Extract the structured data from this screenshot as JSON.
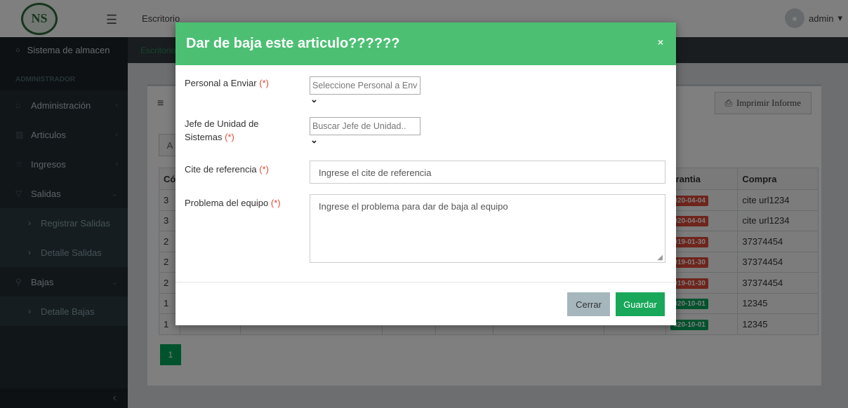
{
  "topbar": {
    "logo_text": "NS",
    "breadcrumb_title": "Escritorio",
    "user": "admin"
  },
  "sidebar": {
    "brand": "Sistema de almacen",
    "section": "ADMINISTRADOR",
    "items": [
      {
        "label": "Administración"
      },
      {
        "label": "Articulos"
      },
      {
        "label": "Ingresos"
      },
      {
        "label": "Salidas"
      },
      {
        "label": "Registrar Salidas"
      },
      {
        "label": "Detalle Salidas"
      },
      {
        "label": "Bajas"
      },
      {
        "label": "Detalle Bajas"
      }
    ]
  },
  "breadcrumb": "Escritorio",
  "card": {
    "print_label": "Imprimir Informe",
    "tab_label": "A",
    "pager": "1"
  },
  "table": {
    "headers": [
      "Có",
      "arantia",
      "Compra"
    ],
    "rows": [
      {
        "code": "3",
        "date": "020-04-04",
        "status": "red",
        "compra": "cite url1234"
      },
      {
        "code": "3",
        "date": "020-04-04",
        "status": "red",
        "compra": "cite url1234"
      },
      {
        "code": "2",
        "date": "019-01-30",
        "status": "red",
        "compra": "37374454"
      },
      {
        "code": "2",
        "date": "019-01-30",
        "status": "red",
        "compra": "37374454"
      },
      {
        "code": "2",
        "date": "019-01-30",
        "status": "red",
        "compra": "37374454"
      },
      {
        "code": "1",
        "date": "020-10-01",
        "status": "green",
        "compra": "12345"
      },
      {
        "code": "1",
        "date": "020-10-01",
        "status": "green",
        "compra": "12345"
      }
    ]
  },
  "modal": {
    "title": "Dar de baja este articulo??????",
    "close_glyph": "×",
    "fields": {
      "personal_label": "Personal a Enviar",
      "personal_placeholder": "Seleccione Personal a Env",
      "jefe_label_1": "Jefe de Unidad de",
      "jefe_label_2": "Sistemas",
      "jefe_placeholder": "Buscar Jefe de Unidad..",
      "cite_label": "Cite de referencia",
      "cite_placeholder": "Ingrese el cite de referencia",
      "problema_label": "Problema del equipo",
      "problema_placeholder": "Ingrese el problema para dar de baja al equipo",
      "required_mark": "(*)"
    },
    "buttons": {
      "close": "Cerrar",
      "save": "Guardar"
    }
  }
}
